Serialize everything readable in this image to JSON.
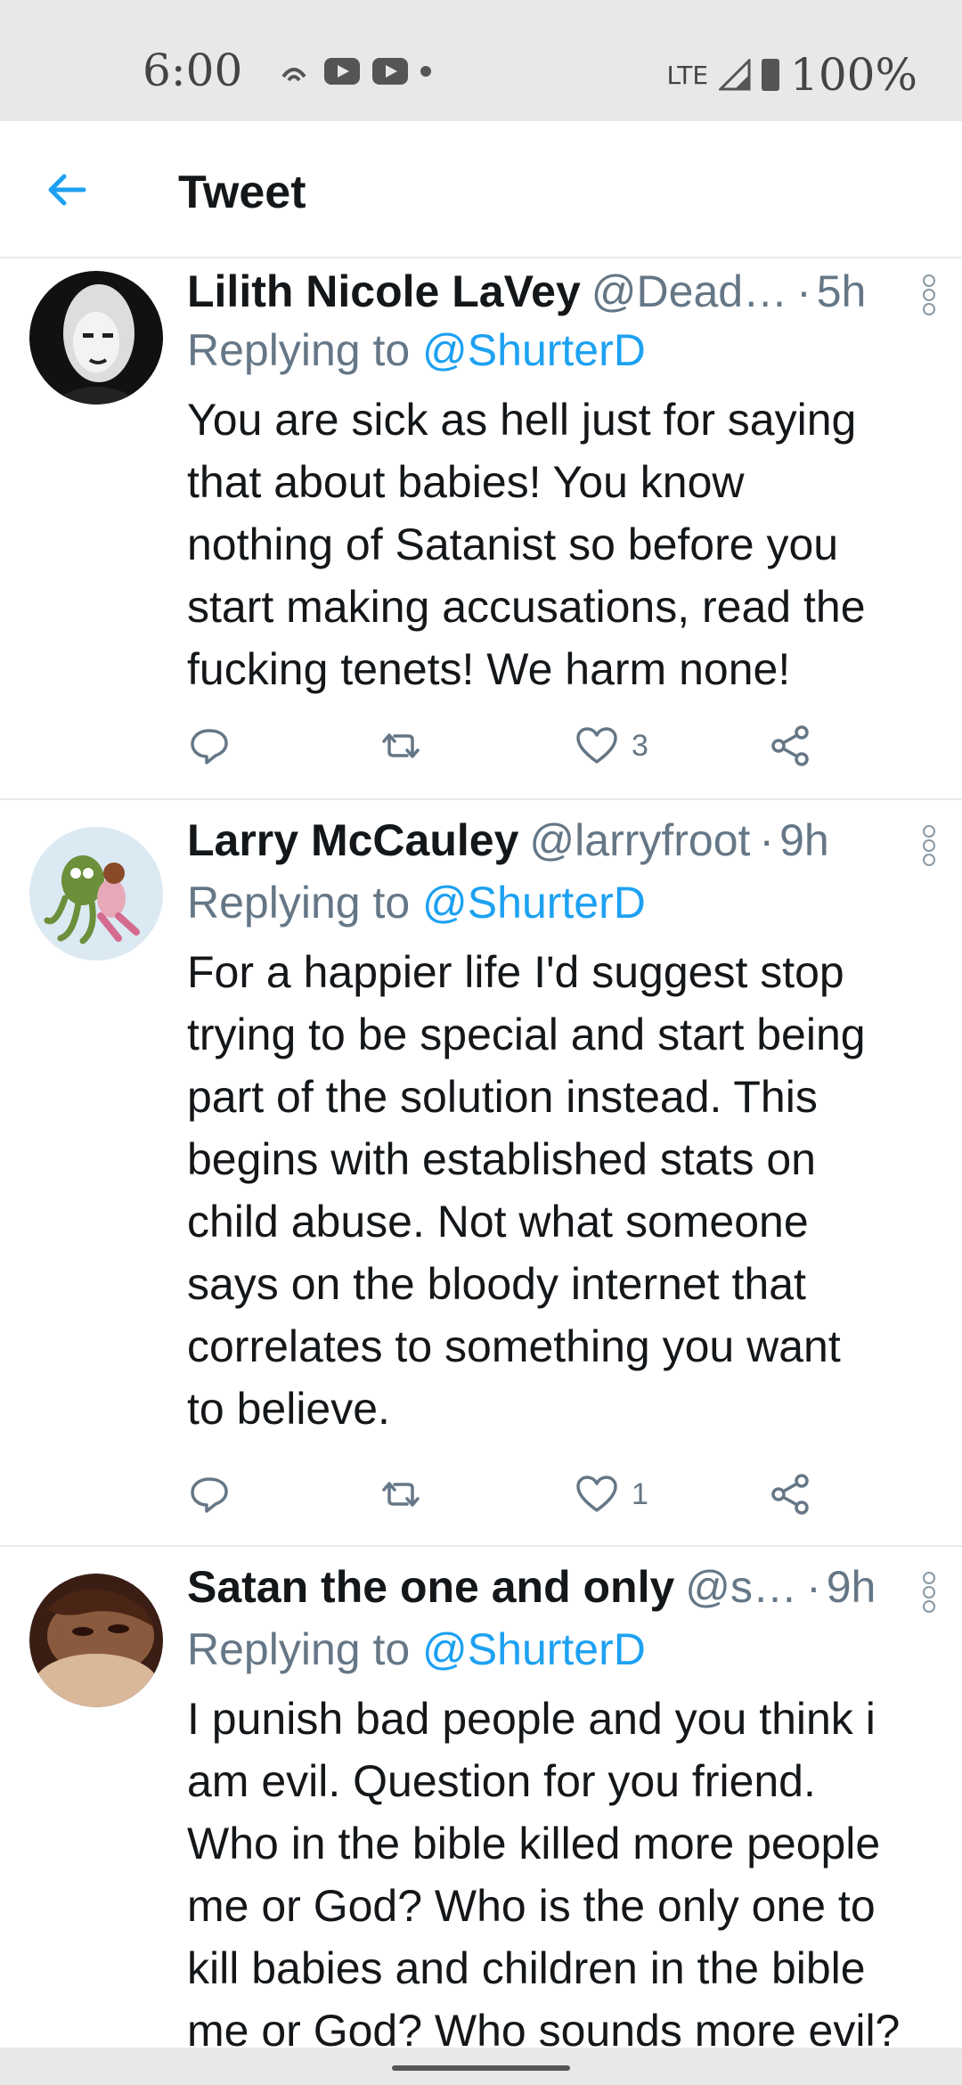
{
  "status_bar": {
    "time": "6:00",
    "network": "LTE",
    "battery": "100%"
  },
  "header": {
    "back_icon": "arrow-left-icon",
    "title": "Tweet"
  },
  "colors": {
    "accent": "#1da1f2",
    "text": "#14171a",
    "secondary": "#657786",
    "divider": "#e6ecf0"
  },
  "tweets": [
    {
      "name": "Lilith Nicole LaVey",
      "handle": "@Dead…",
      "time": "5h",
      "replying_prefix": "Replying to ",
      "replying_to": "@ShurterD",
      "lines": [
        "You are sick as hell just for saying",
        "that about babies! You know",
        "nothing of Satanist so before you",
        "start making accusations, read the",
        "fucking tenets! We harm none!"
      ],
      "like_count": "3"
    },
    {
      "name": "Larry McCauley",
      "handle": "@larryfroot",
      "time": "9h",
      "replying_prefix": "Replying to ",
      "replying_to": "@ShurterD",
      "lines": [
        "For a happier life I'd suggest stop",
        "trying to be special and start being",
        "part of the solution instead. This",
        "begins with established stats on",
        "child abuse. Not what someone",
        "says on the bloody internet that",
        "correlates to something you want",
        "to believe."
      ],
      "like_count": "1"
    },
    {
      "name": "Satan the one and only",
      "handle": "@s…",
      "time": "9h",
      "replying_prefix": "Replying to ",
      "replying_to": "@ShurterD",
      "lines": [
        "I punish bad people and you think i",
        "am evil. Question for you friend.",
        "Who in the bible killed more people",
        "me or God? Who is the only one to",
        "kill babies and children in the bible",
        "me or God? Who sounds more evil?"
      ]
    }
  ]
}
